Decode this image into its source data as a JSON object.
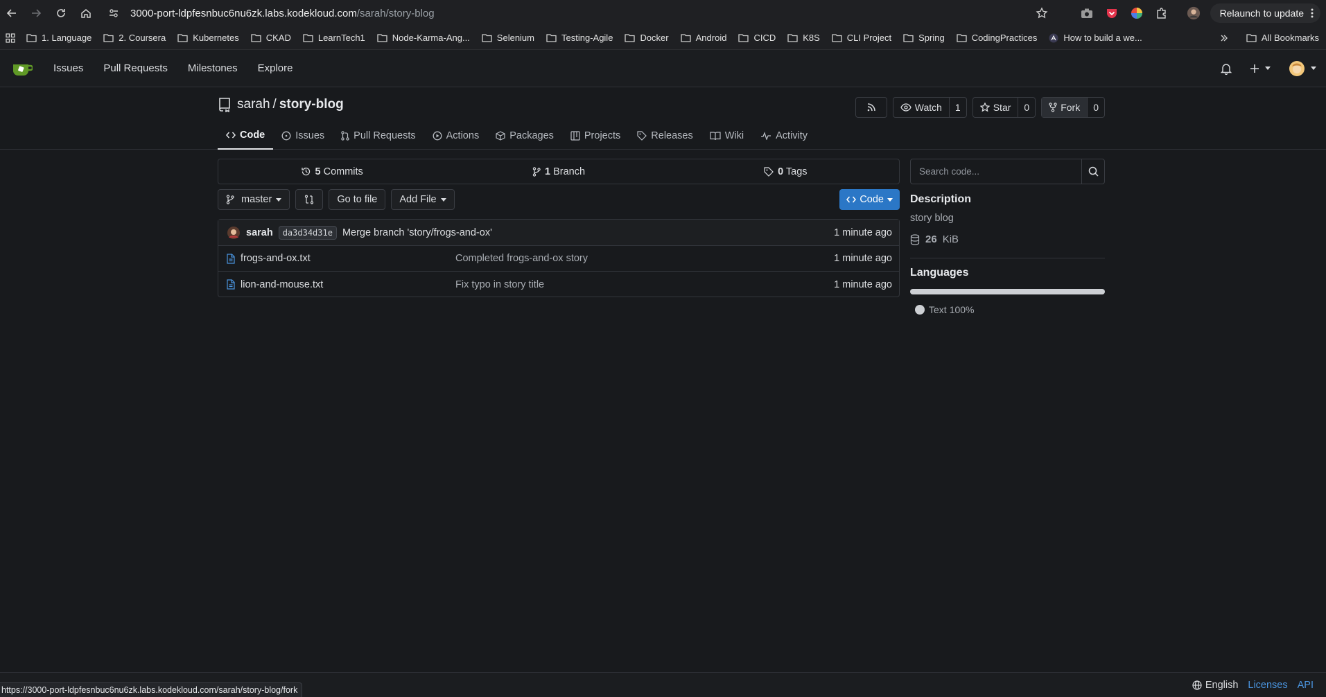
{
  "browser": {
    "url_host": "3000-port-ldpfesnbuc6nu6zk.labs.kodekloud.com",
    "url_path": "/sarah/story-blog",
    "relaunch_label": "Relaunch to update",
    "status_url": "https://3000-port-ldpfesnbuc6nu6zk.labs.kodekloud.com/sarah/story-blog/fork"
  },
  "bookmarks": {
    "items": [
      {
        "label": "1. Language"
      },
      {
        "label": "2. Coursera"
      },
      {
        "label": "Kubernetes"
      },
      {
        "label": "CKAD"
      },
      {
        "label": "LearnTech1"
      },
      {
        "label": "Node-Karma-Ang..."
      },
      {
        "label": "Selenium"
      },
      {
        "label": "Testing-Agile"
      },
      {
        "label": "Docker"
      },
      {
        "label": "Android"
      },
      {
        "label": "CICD"
      },
      {
        "label": "K8S"
      },
      {
        "label": "CLI Project"
      },
      {
        "label": "Spring"
      },
      {
        "label": "CodingPractices"
      },
      {
        "label": "How to build a we..."
      }
    ],
    "all_bookmarks": "All Bookmarks"
  },
  "nav": {
    "issues": "Issues",
    "pull_requests": "Pull Requests",
    "milestones": "Milestones",
    "explore": "Explore"
  },
  "repo": {
    "owner": "sarah",
    "separator": "/",
    "name": "story-blog",
    "watch_label": "Watch",
    "watch_count": "1",
    "star_label": "Star",
    "star_count": "0",
    "fork_label": "Fork",
    "fork_count": "0"
  },
  "tabs": {
    "code": "Code",
    "issues": "Issues",
    "pull_requests": "Pull Requests",
    "actions": "Actions",
    "packages": "Packages",
    "projects": "Projects",
    "releases": "Releases",
    "wiki": "Wiki",
    "activity": "Activity"
  },
  "stats": {
    "commits_count": "5",
    "commits_label": "Commits",
    "branch_count": "1",
    "branch_label": "Branch",
    "tags_count": "0",
    "tags_label": "Tags"
  },
  "toolbar": {
    "branch": "master",
    "go_to_file": "Go to file",
    "add_file": "Add File",
    "code_button": "Code"
  },
  "latest_commit": {
    "author": "sarah",
    "sha": "da3d34d31e",
    "message": "Merge branch 'story/frogs-and-ox'",
    "time": "1 minute ago"
  },
  "files": [
    {
      "name": "frogs-and-ox.txt",
      "message": "Completed frogs-and-ox story",
      "time": "1 minute ago"
    },
    {
      "name": "lion-and-mouse.txt",
      "message": "Fix typo in story title",
      "time": "1 minute ago"
    }
  ],
  "sidebar": {
    "search_placeholder": "Search code...",
    "description_heading": "Description",
    "description": "story blog",
    "size_value": "26",
    "size_unit": "KiB",
    "languages_heading": "Languages",
    "language_name": "Text",
    "language_percent": "100%",
    "language_fraction": 1.0
  },
  "footer": {
    "language": "English",
    "licenses": "Licenses",
    "api": "API"
  },
  "colors": {
    "accent": "#2b77c6",
    "background": "#181a1d",
    "link": "#4a95e0"
  }
}
